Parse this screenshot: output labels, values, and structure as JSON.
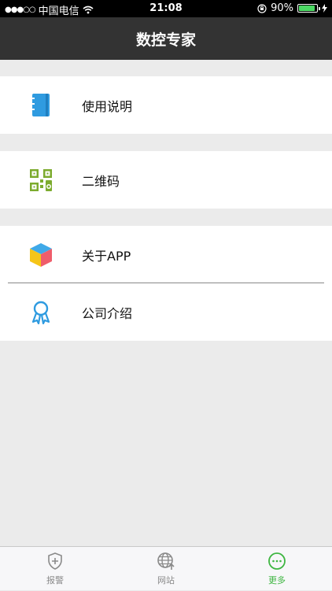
{
  "status_bar": {
    "carrier": "中国电信",
    "time": "21:08",
    "battery_percent": "90%",
    "battery_level": 0.9
  },
  "header": {
    "title": "数控专家"
  },
  "menu": {
    "groups": [
      {
        "items": [
          {
            "label": "使用说明",
            "icon": "manual-book-icon"
          }
        ]
      },
      {
        "items": [
          {
            "label": "二维码",
            "icon": "qr-code-icon"
          }
        ]
      },
      {
        "items": [
          {
            "label": "关于APP",
            "icon": "cube-icon"
          },
          {
            "label": "公司介绍",
            "icon": "award-ribbon-icon"
          }
        ]
      }
    ]
  },
  "tab_bar": {
    "tabs": [
      {
        "label": "报警",
        "icon": "shield-plus-icon",
        "active": false
      },
      {
        "label": "网站",
        "icon": "globe-upload-icon",
        "active": false
      },
      {
        "label": "更多",
        "icon": "more-dots-icon",
        "active": true
      }
    ]
  },
  "colors": {
    "nav_background": "#333333",
    "page_background": "#ebebeb",
    "tab_active": "#3fb642",
    "tab_inactive": "#8a8a8a",
    "battery_fill": "#4cd964"
  }
}
